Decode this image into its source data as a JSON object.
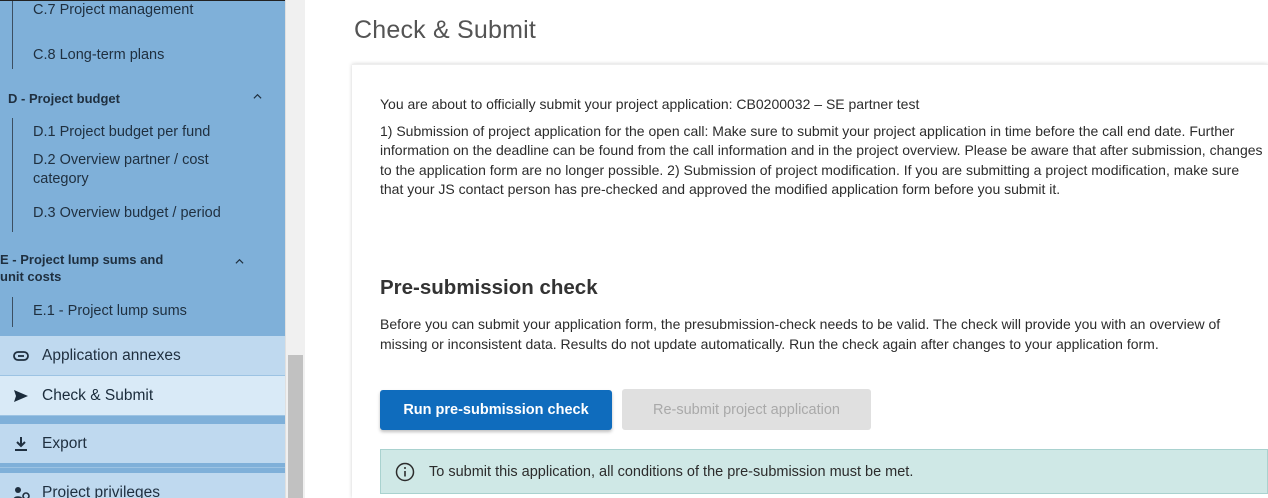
{
  "sidebar": {
    "group_c": {
      "items": [
        "C.7 Project management",
        "C.8 Long-term plans"
      ]
    },
    "group_d": {
      "title": "D - Project budget",
      "items": [
        "D.1 Project budget per fund",
        "D.2 Overview partner / cost category",
        "D.3 Overview budget / period"
      ]
    },
    "group_e": {
      "title_line1": "E - Project lump sums and",
      "title_line2": "unit costs",
      "items": [
        "E.1 - Project lump sums"
      ]
    },
    "nav": {
      "annexes": "Application annexes",
      "check_submit": "Check & Submit",
      "export": "Export",
      "privileges": "Project privileges"
    }
  },
  "main": {
    "title": "Check & Submit",
    "intro_line": "You are about to officially submit your project application: CB0200032 – SE partner test",
    "intro_paragraph": "1) Submission of project application for the open call: Make sure to submit your project application in time before the call end date. Further information on the deadline can be found from the call information and in the project overview. Please be aware that after submission, changes to the application form are no longer possible. 2) Submission of project modification. If you are submitting a project modification, make sure that your JS contact person has pre-checked and approved the modified application form before you submit it.",
    "precheck_title": "Pre-submission check",
    "precheck_desc": "Before you can submit your application form, the presubmission-check needs to be valid. The check will provide you with an overview of missing or inconsistent data. Results do not update automatically. Run the check again after changes to your application form.",
    "run_button": "Run pre-submission check",
    "resubmit_button": "Re-submit project application",
    "alert_text": "To submit this application, all conditions of the pre-submission must be met."
  },
  "colors": {
    "sidebar_bg": "#7fb0d9",
    "primary": "#0f6cbd",
    "alert_bg": "#cfe8e6"
  }
}
